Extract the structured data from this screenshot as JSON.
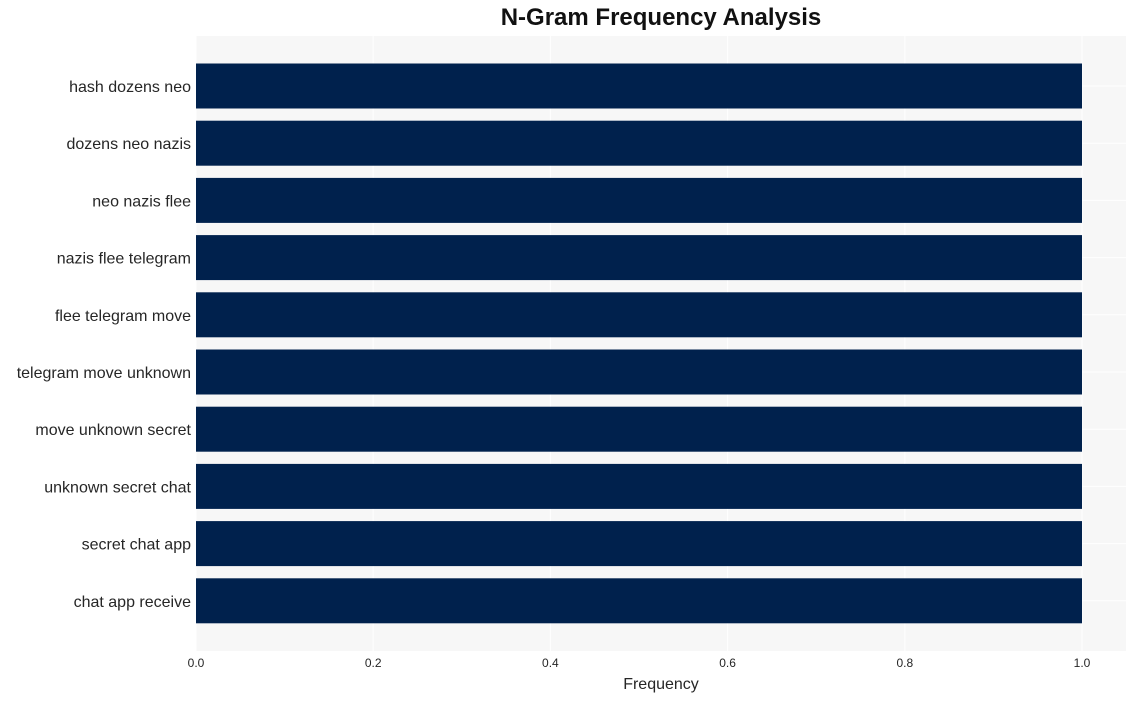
{
  "chart_data": {
    "type": "bar",
    "orientation": "horizontal",
    "title": "N-Gram Frequency Analysis",
    "xlabel": "Frequency",
    "ylabel": "",
    "categories": [
      "hash dozens neo",
      "dozens neo nazis",
      "neo nazis flee",
      "nazis flee telegram",
      "flee telegram move",
      "telegram move unknown",
      "move unknown secret",
      "unknown secret chat",
      "secret chat app",
      "chat app receive"
    ],
    "values": [
      1,
      1,
      1,
      1,
      1,
      1,
      1,
      1,
      1,
      1
    ],
    "xlim": [
      0,
      1.05
    ],
    "xticks": [
      "0.0",
      "0.2",
      "0.4",
      "0.6",
      "0.8",
      "1.0"
    ],
    "grid": true,
    "legend": "none",
    "colors": {
      "bar": "#00214d",
      "plot_background": "#f7f7f7",
      "grid": "#ffffff"
    }
  }
}
